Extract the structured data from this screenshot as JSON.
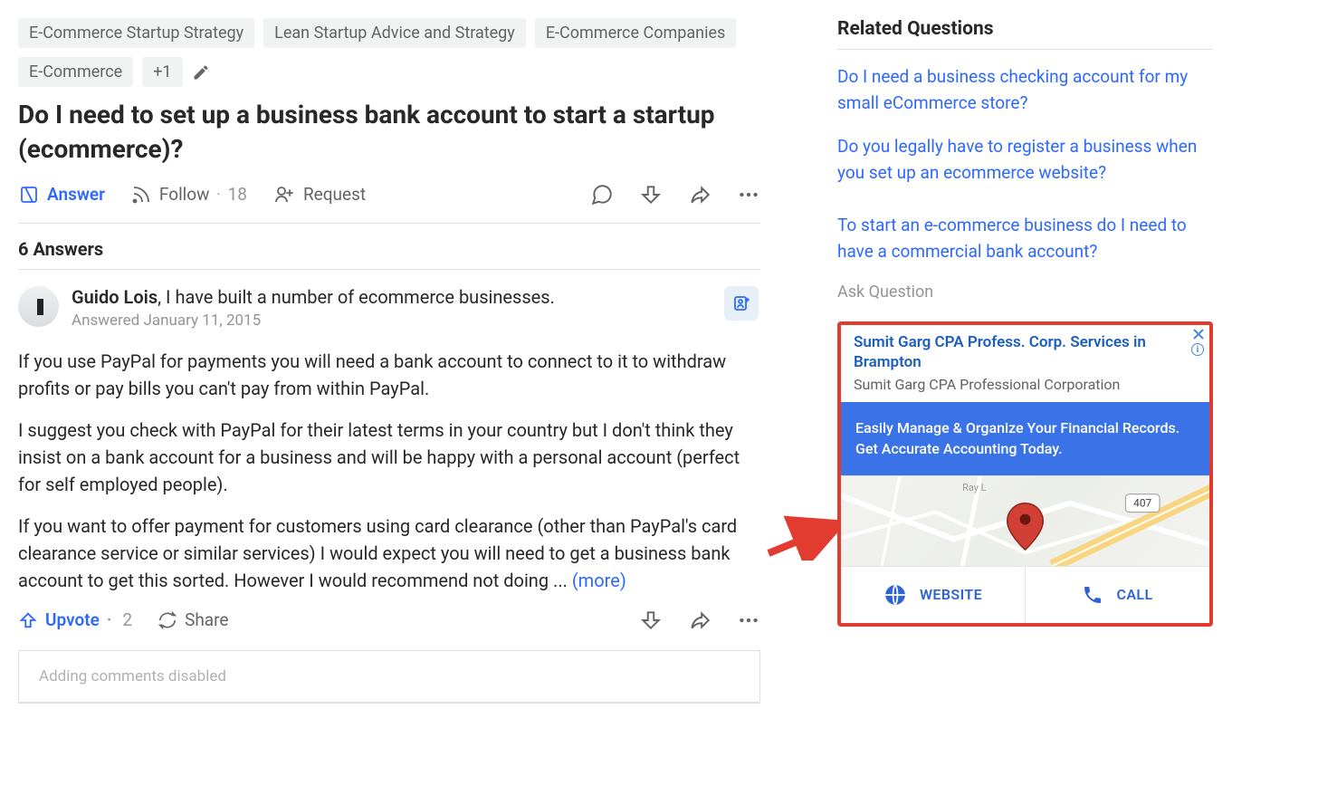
{
  "tags": [
    "E-Commerce Startup Strategy",
    "Lean Startup Advice and Strategy",
    "E-Commerce Companies",
    "E-Commerce"
  ],
  "tags_more": "+1",
  "question": "Do I need to set up a business bank account to start a startup (ecommerce)?",
  "actions": {
    "answer": "Answer",
    "follow": "Follow",
    "follow_count": "18",
    "request": "Request"
  },
  "answers_heading": "6 Answers",
  "answer": {
    "author": "Guido Lois",
    "credential": ", I have built a number of ecommerce businesses.",
    "date_prefix": "Answered ",
    "date": "January 11, 2015",
    "p1": "If you use PayPal for payments you will need a bank account to connect to it to withdraw profits or pay bills you can't pay from within PayPal.",
    "p2": "I suggest you check with PayPal for their latest terms in your country but I don't think they insist on a bank account for a business and will be happy with a personal account (perfect for self employed people).",
    "p3": "If you want to offer payment for customers using card clearance (other than PayPal's card clearance service or similar services) I would expect you will need to get a business bank account to get this sorted. However I would recommend not doing ... ",
    "more": "(more)"
  },
  "answer_actions": {
    "upvote": "Upvote",
    "upvote_count": "2",
    "share": "Share"
  },
  "comment_box": "Adding comments disabled",
  "sidebar": {
    "title": "Related Questions",
    "links": [
      "Do I need a business checking account for my small eCommerce store?",
      "Do you legally have to register a business when you set up an ecommerce website?",
      "To start an e-commerce business do I need to have a commercial bank account?"
    ],
    "ask": "Ask Question"
  },
  "ad": {
    "title": "Sumit Garg CPA Profess. Corp. Services in Brampton",
    "subtitle": "Sumit Garg CPA Professional Corporation",
    "banner": "Easily Manage & Organize Your Financial Records. Get Accurate Accounting Today.",
    "route_label": "407",
    "website_btn": "WEBSITE",
    "call_btn": "CALL"
  }
}
